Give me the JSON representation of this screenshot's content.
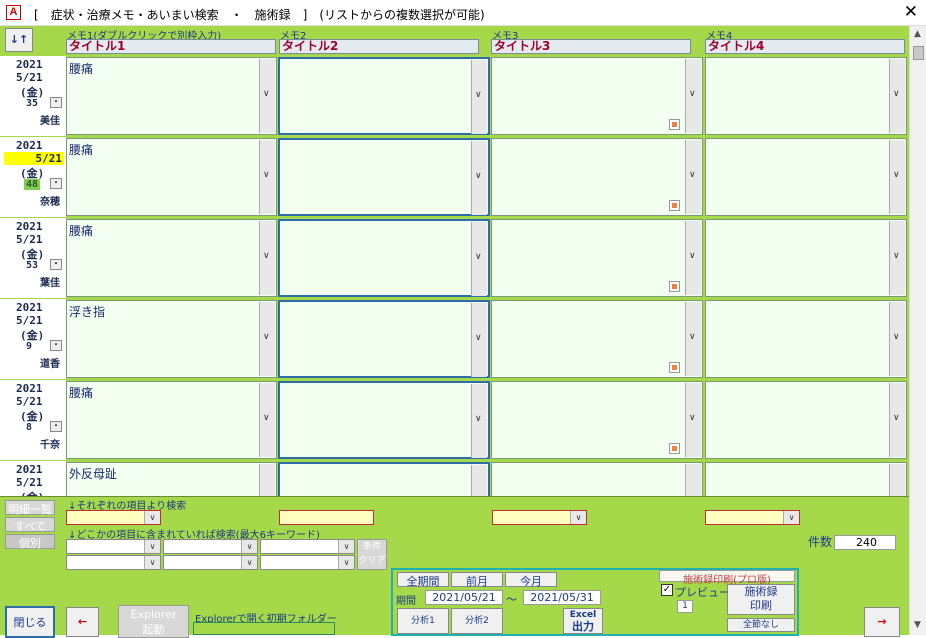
{
  "window": {
    "app_icon": "A",
    "title": "[　症状・治療メモ・あいまい検索　・　施術録　]　(リストからの複数選択が可能)",
    "close_label": "✕"
  },
  "header": {
    "sort_label": "↓↑",
    "memo_columns": [
      {
        "caption": "メモ1(ダブルクリックで別枠入力)",
        "title": "タイトル1"
      },
      {
        "caption": "メモ2",
        "title": "タイトル2"
      },
      {
        "caption": "メモ3",
        "title": "タイトル3"
      },
      {
        "caption": "メモ4",
        "title": "タイトル4"
      }
    ]
  },
  "rows": [
    {
      "year": "2021",
      "md": "5/21",
      "wd": "(金)",
      "num": "35",
      "name": "美佳",
      "memo1": "腰痛"
    },
    {
      "year": "2021",
      "md": "5/21",
      "wd": "(金)",
      "num": "48",
      "name": "奈穂",
      "memo1": "腰痛"
    },
    {
      "year": "2021",
      "md": "5/21",
      "wd": "(金)",
      "num": "53",
      "name": "葉佳",
      "memo1": "腰痛"
    },
    {
      "year": "2021",
      "md": "5/21",
      "wd": "(金)",
      "num": "9",
      "name": "道香",
      "memo1": "浮き指"
    },
    {
      "year": "2021",
      "md": "5/21",
      "wd": "(金)",
      "num": "8",
      "name": "千奈",
      "memo1": "腰痛"
    },
    {
      "year": "2021",
      "md": "5/21",
      "wd": "(金)",
      "num": "",
      "name": "",
      "memo1": "外反母趾"
    }
  ],
  "dot_label": "・",
  "bottom": {
    "left_buttons": [
      "明細一覧",
      "すべて",
      "個別"
    ],
    "search_each_label": "↓それぞれの項目より検索",
    "search_any_label": "↓どこかの項目に含まれていれば検索(最大6キーワード)",
    "cond_clear_label_1": "条件",
    "cond_clear_label_2": "クリア",
    "close_label": "閉じる",
    "prev_label": "←",
    "next_label": "→",
    "explorer_label_1": "Explorer",
    "explorer_label_2": "起動",
    "explorer_folder_label": "Explorerで開く初期フォルダー",
    "period_buttons": [
      "全期間",
      "前月",
      "今月"
    ],
    "period_label": "期間",
    "date_from": "2021/05/21",
    "date_sep": "～",
    "date_to": "2021/05/31",
    "analysis1": "分析1",
    "analysis2": "分析2",
    "excel_1": "Excel",
    "excel_2": "出力",
    "print_caption": "施術録印刷(プロ版)",
    "preview_label": "プレビュー",
    "preview_checked": true,
    "copies": "1",
    "print_btn_1": "施術録",
    "print_btn_2": "印刷",
    "no_cover_label": "全節なし",
    "count_label": "件数",
    "count_value": "240"
  },
  "colors": {
    "background": "#a6d94a",
    "memo_bg": "#f2fff0",
    "title_text": "#a0002a",
    "highlight": "#ffff00",
    "panel_border": "#20b0b0"
  }
}
